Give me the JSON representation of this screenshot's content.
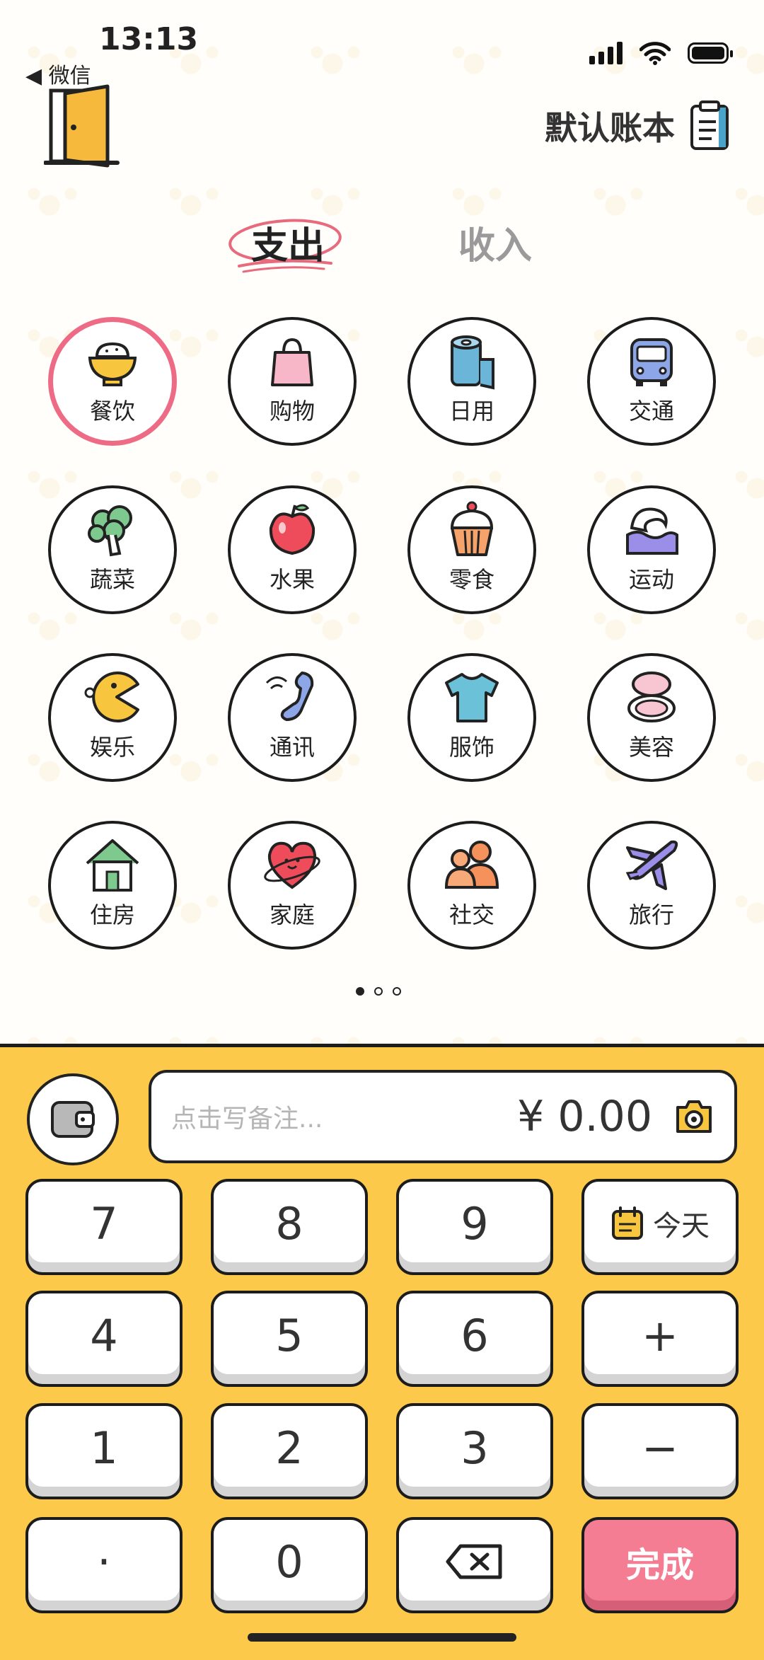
{
  "status_bar": {
    "time": "13:13",
    "back_label": "◀ 微信"
  },
  "header": {
    "ledger_label": "默认账本"
  },
  "tabs": {
    "expense": "支出",
    "income": "收入"
  },
  "categories": [
    {
      "label": "餐饮",
      "icon": "rice-bowl-icon",
      "selected": true
    },
    {
      "label": "购物",
      "icon": "shopping-bag-icon"
    },
    {
      "label": "日用",
      "icon": "tissue-roll-icon"
    },
    {
      "label": "交通",
      "icon": "bus-icon"
    },
    {
      "label": "蔬菜",
      "icon": "broccoli-icon"
    },
    {
      "label": "水果",
      "icon": "apple-icon"
    },
    {
      "label": "零食",
      "icon": "cupcake-icon"
    },
    {
      "label": "运动",
      "icon": "wave-icon"
    },
    {
      "label": "娱乐",
      "icon": "pacman-icon"
    },
    {
      "label": "通讯",
      "icon": "phone-icon"
    },
    {
      "label": "服饰",
      "icon": "tshirt-icon"
    },
    {
      "label": "美容",
      "icon": "compact-mirror-icon"
    },
    {
      "label": "住房",
      "icon": "house-icon"
    },
    {
      "label": "家庭",
      "icon": "heart-icon"
    },
    {
      "label": "社交",
      "icon": "people-icon"
    },
    {
      "label": "旅行",
      "icon": "airplane-icon"
    }
  ],
  "input": {
    "note_placeholder": "点击写备注...",
    "amount": "¥ 0.00"
  },
  "keypad": {
    "k7": "7",
    "k8": "8",
    "k9": "9",
    "today": "今天",
    "k4": "4",
    "k5": "5",
    "k6": "6",
    "plus": "+",
    "k1": "1",
    "k2": "2",
    "k3": "3",
    "minus": "−",
    "dot": "·",
    "k0": "0",
    "done": "完成"
  },
  "colors": {
    "accent_pink": "#f47d93",
    "panel_yellow": "#fcc94a",
    "selected_ring": "#ee6b86"
  }
}
